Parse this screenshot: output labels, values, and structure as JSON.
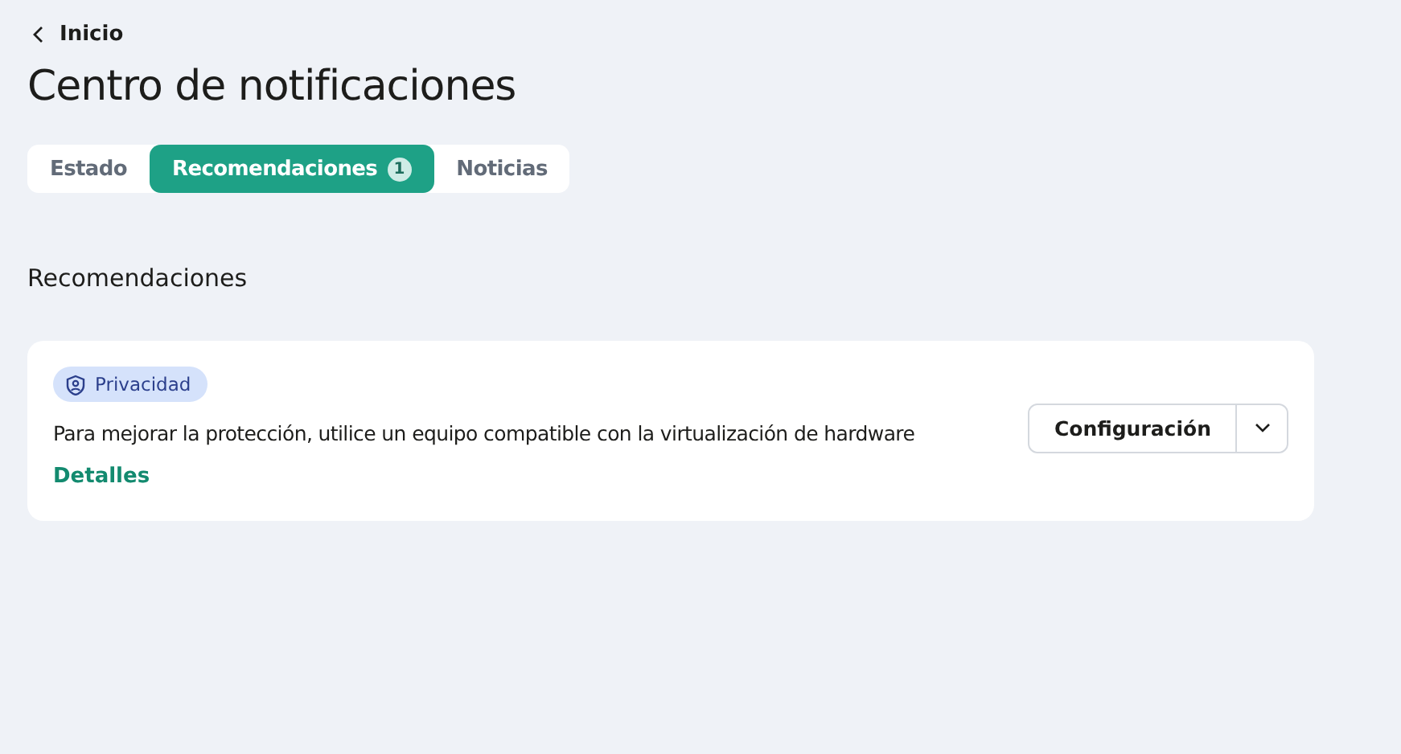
{
  "back_link": {
    "label": "Inicio"
  },
  "page_title": "Centro de notificaciones",
  "tabs": [
    {
      "label": "Estado",
      "selected": false
    },
    {
      "label": "Recomendaciones",
      "badge": "1",
      "selected": true
    },
    {
      "label": "Noticias",
      "selected": false
    }
  ],
  "section_title": "Recomendaciones",
  "recommendations": [
    {
      "tag": "Privacidad",
      "text": "Para mejorar la protección, utilice un equipo compatible con la virtualización de hardware",
      "link": "Detalles",
      "action": "Configuración"
    }
  ]
}
